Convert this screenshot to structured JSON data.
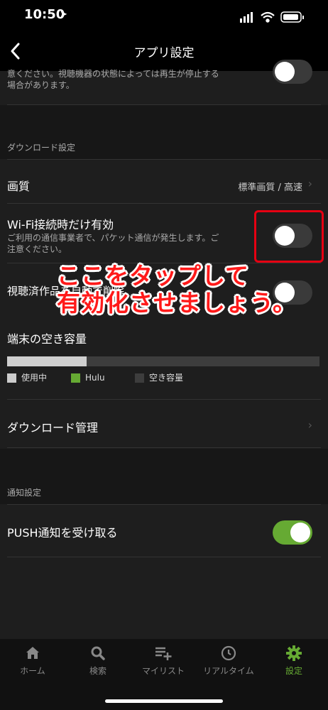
{
  "status": {
    "time": "10:50",
    "location_icon": "location-arrow-icon"
  },
  "nav": {
    "title": "アプリ設定",
    "back_icon": "chevron-left-icon"
  },
  "top_note": {
    "line1": "意ください。視聴機器の状態によっては再生が停止する",
    "line2": "場合があります。"
  },
  "download_section": {
    "header": "ダウンロード設定",
    "quality": {
      "label": "画質",
      "value": "標準画質 / 高速"
    },
    "wifi_only": {
      "label": "Wi-Fi接続時だけ有効",
      "desc1": "ご利用の通信事業者で、パケット通信が発生します。ご",
      "desc2": "注意ください。",
      "enabled": false
    },
    "auto_delete": {
      "label": "視聴済作品を自動で削除",
      "enabled": false
    },
    "storage": {
      "label": "端末の空き容量",
      "used_fraction": 0.255,
      "legend": [
        {
          "name": "使用中",
          "color": "#cccccc"
        },
        {
          "name": "Hulu",
          "color": "#66aa33"
        },
        {
          "name": "空き容量",
          "color": "#3d3d3d"
        }
      ]
    },
    "manage": {
      "label": "ダウンロード管理"
    }
  },
  "notify_section": {
    "header": "通知設定",
    "push": {
      "label": "PUSH通知を受け取る",
      "enabled": true
    }
  },
  "annotation": {
    "line1": "ここをタップして",
    "line2": "有効化させましょう。"
  },
  "tabs": [
    {
      "label": "ホーム",
      "icon": "home-icon"
    },
    {
      "label": "検索",
      "icon": "search-icon"
    },
    {
      "label": "マイリスト",
      "icon": "playlist-add-icon"
    },
    {
      "label": "リアルタイム",
      "icon": "clock-icon"
    },
    {
      "label": "設定",
      "icon": "gear-icon",
      "active": true
    }
  ],
  "colors": {
    "accent": "#66aa33",
    "highlight": "#e60012"
  }
}
